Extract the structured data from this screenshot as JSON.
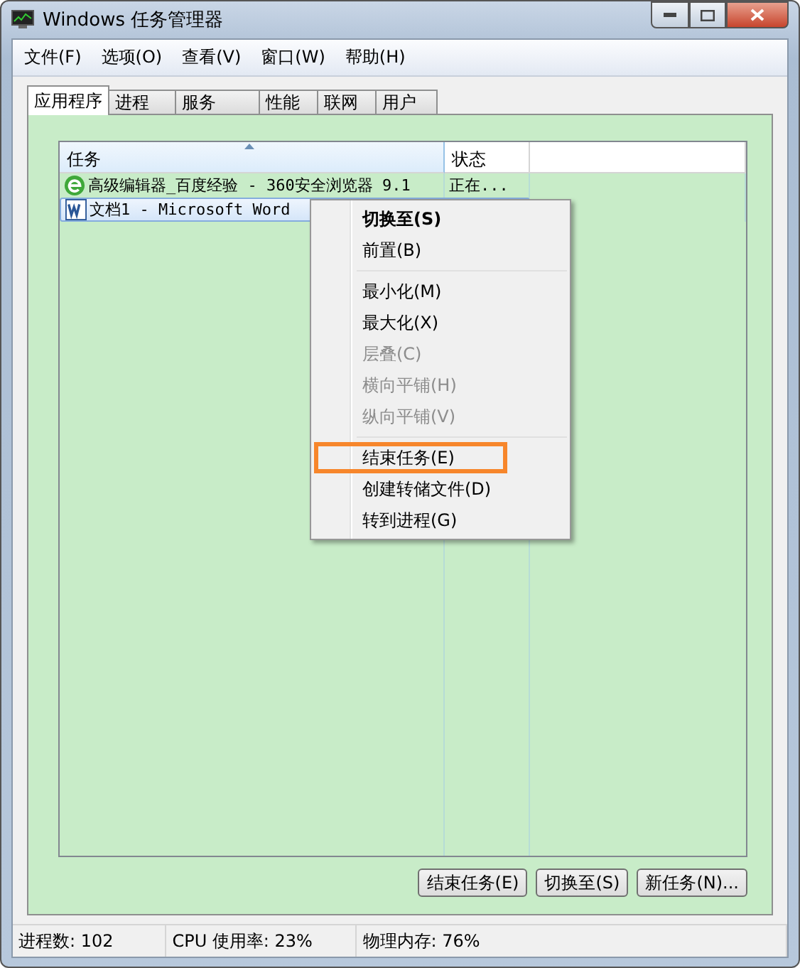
{
  "window": {
    "title": "Windows 任务管理器"
  },
  "menu_bar": [
    "文件(F)",
    "选项(O)",
    "查看(V)",
    "窗口(W)",
    "帮助(H)"
  ],
  "tabs": [
    {
      "label": "应用程序",
      "selected": true
    },
    {
      "label": "进程",
      "selected": false
    },
    {
      "label": "服务",
      "selected": false
    },
    {
      "label": "性能",
      "selected": false
    },
    {
      "label": "联网",
      "selected": false
    },
    {
      "label": "用户",
      "selected": false
    }
  ],
  "table": {
    "columns": [
      "任务",
      "状态"
    ],
    "rows": [
      {
        "kind": "browser",
        "task": "高级编辑器_百度经验 - 360安全浏览器 9.1",
        "status": "正在...",
        "selected": false
      },
      {
        "kind": "word",
        "task": "文档1 - Microsoft Word",
        "selected": true
      }
    ]
  },
  "context_menu": [
    [
      {
        "label": "切换至(S)",
        "default": true,
        "disabled": false,
        "highlighted": false
      },
      {
        "label": "前置(B)",
        "default": false,
        "disabled": false,
        "highlighted": false
      }
    ],
    [
      {
        "label": "最小化(M)",
        "default": false,
        "disabled": false,
        "highlighted": false
      },
      {
        "label": "最大化(X)",
        "default": false,
        "disabled": false,
        "highlighted": false
      },
      {
        "label": "层叠(C)",
        "default": false,
        "disabled": true,
        "highlighted": false
      },
      {
        "label": "横向平铺(H)",
        "default": false,
        "disabled": true,
        "highlighted": false
      },
      {
        "label": "纵向平铺(V)",
        "default": false,
        "disabled": true,
        "highlighted": false
      }
    ],
    [
      {
        "label": "结束任务(E)",
        "default": false,
        "disabled": false,
        "highlighted": true
      },
      {
        "label": "创建转储文件(D)",
        "default": false,
        "disabled": false,
        "highlighted": false
      },
      {
        "label": "转到进程(G)",
        "default": false,
        "disabled": false,
        "highlighted": false
      }
    ]
  ],
  "buttons": [
    "结束任务(E)",
    "切换至(S)",
    "新任务(N)..."
  ],
  "status_bar": [
    "进程数: 102",
    "CPU 使用率: 23%",
    "物理内存: 76%"
  ]
}
